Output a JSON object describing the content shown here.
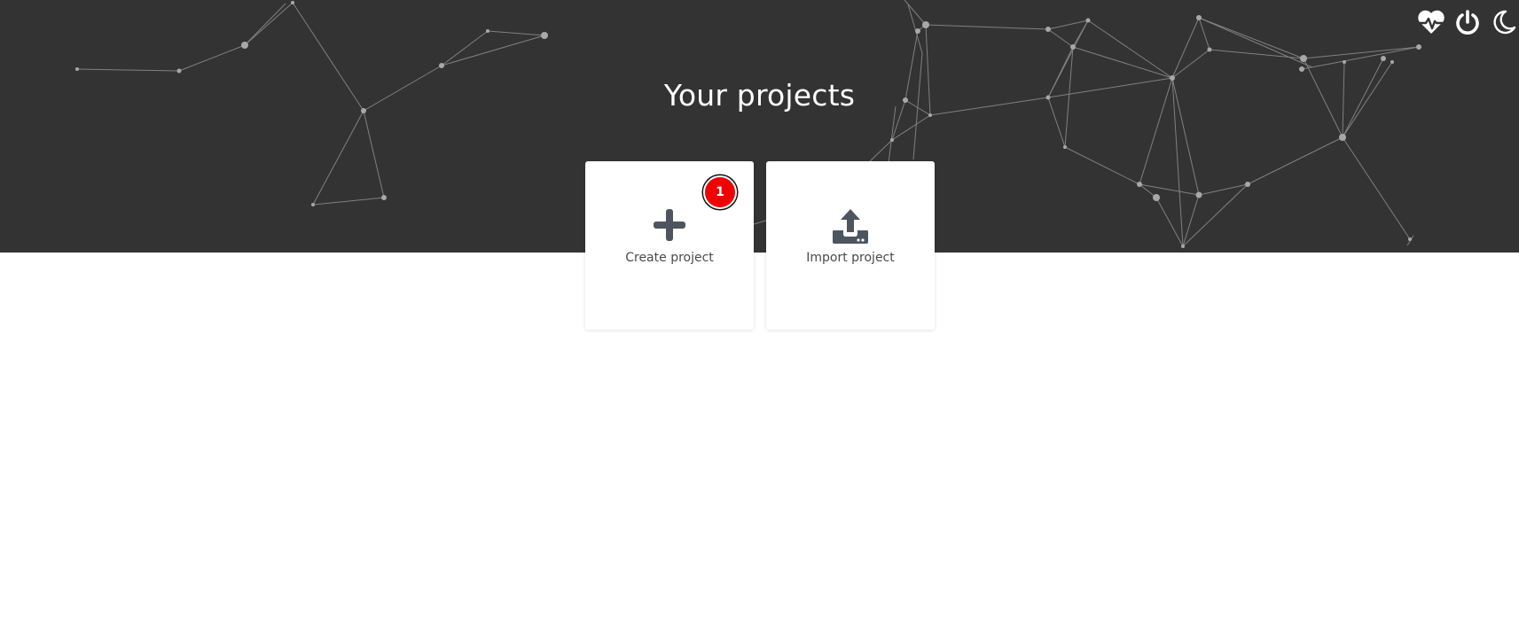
{
  "header": {
    "title": "Your projects",
    "icons": [
      "heartbeat-icon",
      "power-icon",
      "moon-icon"
    ],
    "background_color": "#333333"
  },
  "cards": [
    {
      "label": "Create project",
      "icon": "plus-icon",
      "badge": "1"
    },
    {
      "label": "Import project",
      "icon": "upload-icon"
    }
  ],
  "colors": {
    "badge": "#f00000",
    "icon": "#4d5560",
    "card_text": "#4a4a4a"
  }
}
